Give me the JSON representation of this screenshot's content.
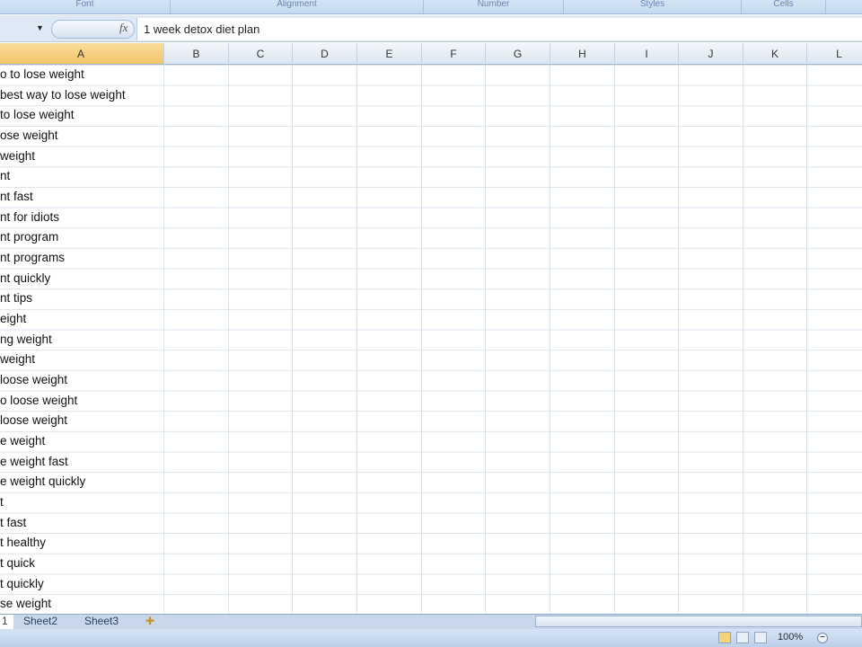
{
  "ribbon": {
    "groups": [
      "Font",
      "Alignment",
      "Number",
      "Styles",
      "Cells"
    ]
  },
  "formula_bar": {
    "fx_label": "fx",
    "value": "1 week detox diet plan"
  },
  "columns": [
    "A",
    "B",
    "C",
    "D",
    "E",
    "F",
    "G",
    "H",
    "I",
    "J",
    "K",
    "L"
  ],
  "cells_A": [
    "o to lose weight",
    "best way to lose weight",
    "to lose weight",
    "ose weight",
    "weight",
    "nt",
    "nt fast",
    "nt for idiots",
    "nt program",
    "nt programs",
    "nt quickly",
    "nt tips",
    "eight",
    "ng weight",
    "weight",
    "loose weight",
    "o loose weight",
    "loose weight",
    "e weight",
    "e weight fast",
    "e weight quickly",
    "t",
    "t fast",
    "t healthy",
    "t quick",
    "t quickly",
    "se weight"
  ],
  "sheet_tabs": [
    "1",
    "Sheet2",
    "Sheet3"
  ],
  "status": {
    "zoom": "100%"
  }
}
